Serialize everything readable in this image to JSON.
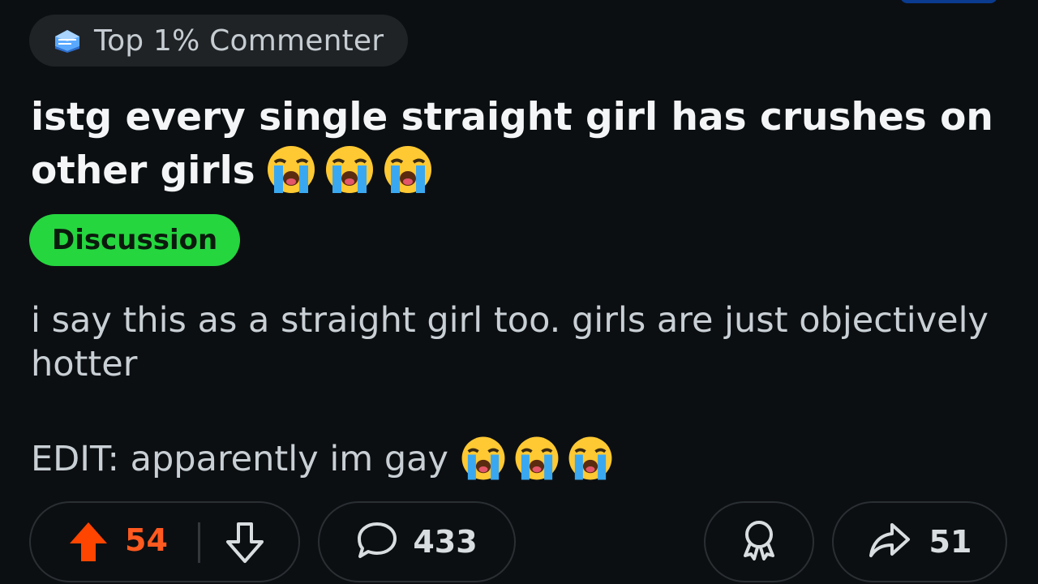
{
  "flair": {
    "label": "Top 1% Commenter",
    "icon": "commenter-badge-icon"
  },
  "post": {
    "title": "istg every single straight girl has crushes on other girls",
    "title_emoji": [
      "loudly-crying-face-emoji",
      "loudly-crying-face-emoji",
      "loudly-crying-face-emoji"
    ],
    "tag": "Discussion",
    "body": "i say this as a straight girl too. girls are just objectively hotter",
    "edit": "EDIT: apparently im gay",
    "edit_emoji": [
      "loudly-crying-face-emoji",
      "loudly-crying-face-emoji",
      "loudly-crying-face-emoji"
    ]
  },
  "actions": {
    "upvote_count": "54",
    "comment_count": "433",
    "share_count": "51",
    "upvote_icon": "upvote-arrow-icon",
    "downvote_icon": "downvote-arrow-icon",
    "comment_icon": "speech-bubble-icon",
    "award_icon": "award-ribbon-icon",
    "share_icon": "share-arrow-icon"
  },
  "colors": {
    "background": "#0c0f12",
    "tag_green": "#25d63f",
    "upvote_orange": "#ff5a1f",
    "pill_border": "#2a2f33",
    "badge_bg": "#1f2326",
    "accent_blue": "#0a3b8f"
  }
}
